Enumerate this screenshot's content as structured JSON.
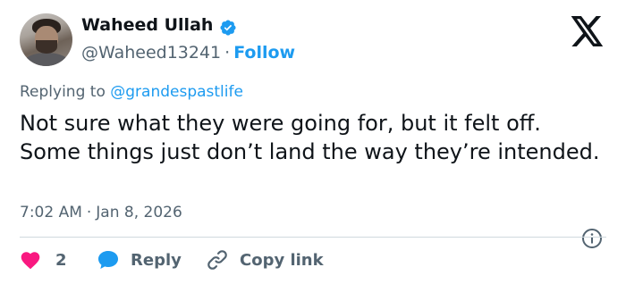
{
  "user": {
    "name": "Waheed Ullah",
    "handle": "@Waheed13241",
    "separator": "·",
    "follow_label": "Follow",
    "verified": true
  },
  "reply_context": {
    "prefix": "Replying to",
    "mention": "@grandespastlife"
  },
  "tweet": {
    "text": "Not sure what they were going for, but it felt off. Some things just don’t land the way they’re intended.",
    "time": "7:02 AM",
    "separator": "·",
    "date": "Jan 8, 2026"
  },
  "actions": {
    "like_count": "2",
    "reply_label": "Reply",
    "copy_label": "Copy link"
  },
  "colors": {
    "accent": "#1d9bf0",
    "like": "#f91880",
    "secondary_text": "#536471"
  },
  "icons": [
    "verified-badge-icon",
    "x-logo-icon",
    "info-icon",
    "heart-icon",
    "reply-bubble-icon",
    "link-icon"
  ]
}
